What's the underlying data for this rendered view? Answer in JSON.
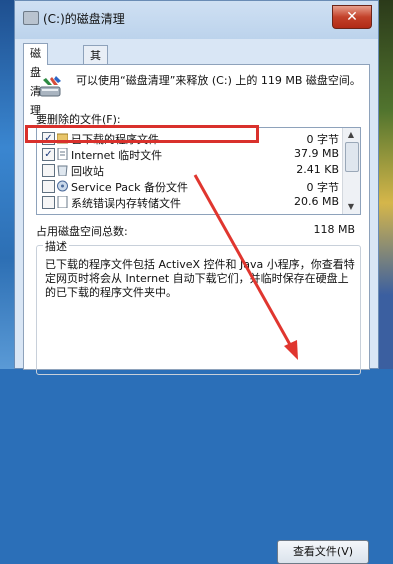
{
  "window": {
    "title": "(C:)的磁盘清理",
    "close_glyph": "✕"
  },
  "tabs": [
    {
      "label": "磁盘清理"
    },
    {
      "label": "其他选项"
    }
  ],
  "intro_text": "可以使用“磁盘清理”来释放 (C:) 上的 119 MB 磁盘空间。",
  "files_label": "要删除的文件(F):",
  "files": [
    {
      "name": "已下载的程序文件",
      "size": "0 字节",
      "checked": true
    },
    {
      "name": "Internet 临时文件",
      "size": "37.9 MB",
      "checked": true
    },
    {
      "name": "回收站",
      "size": "2.41 KB",
      "checked": false
    },
    {
      "name": "Service Pack 备份文件",
      "size": "0 字节",
      "checked": false
    },
    {
      "name": "系统错误内存转储文件",
      "size": "20.6 MB",
      "checked": false
    }
  ],
  "total_label": "占用磁盘空间总数:",
  "total_value": "118 MB",
  "description": {
    "title": "描述",
    "text": "已下载的程序文件包括 ActiveX 控件和 Java 小程序，你查看特定网页时将会从 Internet 自动下载它们，并临时保存在硬盘上的已下载的程序文件夹中。"
  },
  "view_files_button": "查看文件(V)",
  "colors": {
    "highlight": "#d9312c",
    "arrow": "#e0362f"
  }
}
